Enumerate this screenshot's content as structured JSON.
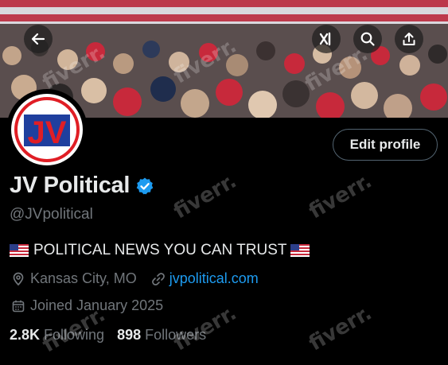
{
  "profile": {
    "display_name": "JV Political",
    "handle": "@JVpolitical",
    "bio_text": "POLITICAL NEWS YOU CAN TRUST",
    "location": "Kansas City, MO",
    "website": "jvpolitical.com",
    "joined": "Joined January 2025",
    "avatar_text": "JV",
    "verified": true
  },
  "stats": {
    "following_count": "2.8K",
    "following_label": "Following",
    "followers_count": "898",
    "followers_label": "Followers"
  },
  "actions": {
    "edit_profile_label": "Edit profile"
  },
  "icons": {
    "back": "arrow-left-icon",
    "grok": "grok-icon",
    "search": "search-icon",
    "share": "share-icon",
    "location": "location-pin-icon",
    "link": "link-icon",
    "calendar": "calendar-icon",
    "verified": "verified-badge-icon",
    "flag": "us-flag-icon"
  },
  "watermark_text": "fiverr.",
  "colors": {
    "background": "#000000",
    "link": "#1d9bf0",
    "verified": "#1d9bf0",
    "muted": "#71767b",
    "text": "#e7e9ea",
    "avatar_red": "#e01e25",
    "avatar_blue": "#1f3f9e"
  }
}
